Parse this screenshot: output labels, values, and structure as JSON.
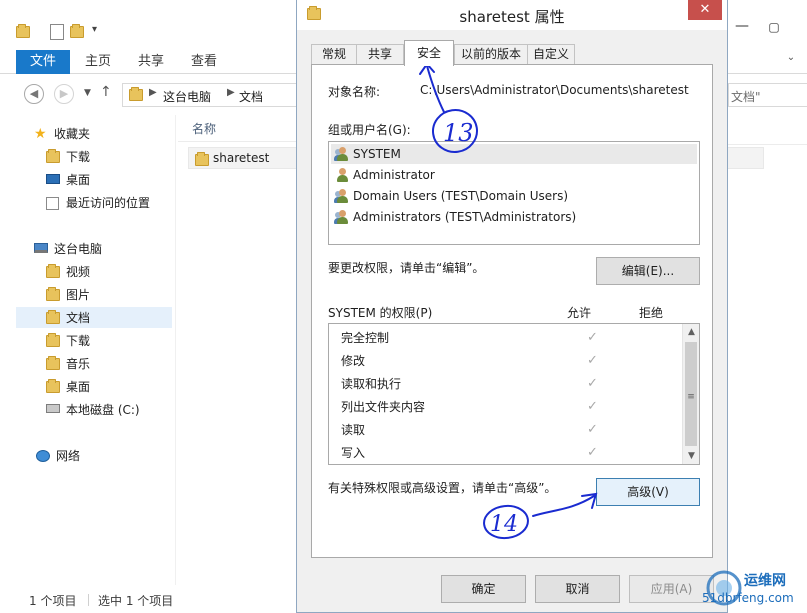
{
  "explorer": {
    "ribbon": {
      "file": "文件",
      "home": "主页",
      "share": "共享",
      "view": "查看"
    },
    "breadcrumb": {
      "pc": "这台电脑",
      "docs": "文档"
    },
    "search_peek": "文档\"",
    "nav": {
      "favorites": "收藏夹",
      "downloads": "下载",
      "desktop": "桌面",
      "recent": "最近访问的位置",
      "this_pc": "这台电脑",
      "videos": "视频",
      "pictures": "图片",
      "documents": "文档",
      "downloads2": "下载",
      "music": "音乐",
      "desktop2": "桌面",
      "local_disk": "本地磁盘 (C:)",
      "network": "网络"
    },
    "column_name": "名称",
    "file": "sharetest",
    "status": {
      "count": "1 个项目",
      "selected": "选中 1 个项目"
    }
  },
  "dialog": {
    "title": "sharetest 属性",
    "tabs": [
      "常规",
      "共享",
      "安全",
      "以前的版本",
      "自定义"
    ],
    "object_label": "对象名称:",
    "object_path": "C:\\Users\\Administrator\\Documents\\sharetest",
    "group_label": "组或用户名(G):",
    "users": [
      "SYSTEM",
      "Administrator",
      "Domain Users (TEST\\Domain Users)",
      "Administrators (TEST\\Administrators)"
    ],
    "edit_hint": "要更改权限，请单击“编辑”。",
    "edit_button": "编辑(E)...",
    "perm_label": "SYSTEM 的权限(P)",
    "allow_col": "允许",
    "deny_col": "拒绝",
    "permissions": [
      "完全控制",
      "修改",
      "读取和执行",
      "列出文件夹内容",
      "读取",
      "写入"
    ],
    "advanced_hint": "有关特殊权限或高级设置，请单击“高级”。",
    "advanced_button": "高级(V)",
    "ok_button": "确定",
    "cancel_button": "取消",
    "apply_button": "应用(A)"
  },
  "annotations": {
    "step_13": "13",
    "step_14": "14"
  },
  "watermark": {
    "line1": "运维网",
    "line2": "51dbrfeng.com"
  },
  "colors": {
    "accent": "#1979ca",
    "close": "#c7504c",
    "annotation": "#1a2bd0"
  }
}
